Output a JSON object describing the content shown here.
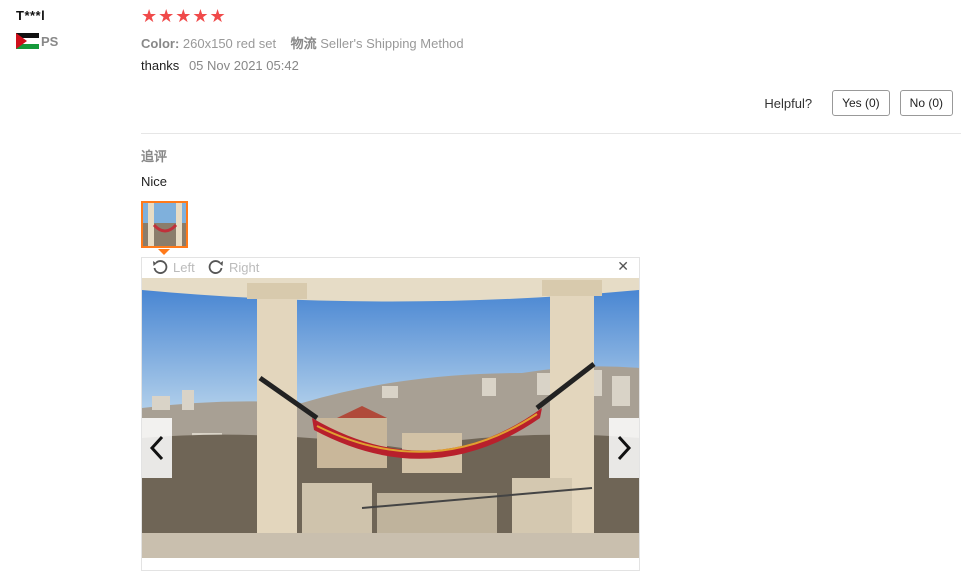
{
  "reviewer": {
    "name": "T***l",
    "country_code": "PS"
  },
  "review": {
    "stars": "★★★★★",
    "color_label": "Color:",
    "color_value": "260x150 red set",
    "shipping_label": "物流",
    "shipping_value": "Seller's Shipping Method",
    "text": "thanks",
    "date": "05 Nov 2021 05:42"
  },
  "helpful": {
    "label": "Helpful?",
    "yes": "Yes (0)",
    "no": "No (0)"
  },
  "followup": {
    "label": "追评",
    "text": "Nice"
  },
  "viewer": {
    "rotate_left": "Left",
    "rotate_right": "Right",
    "close": "✕"
  },
  "colors": {
    "star": "#f04a4a",
    "thumb_border": "#ff7a1a"
  }
}
